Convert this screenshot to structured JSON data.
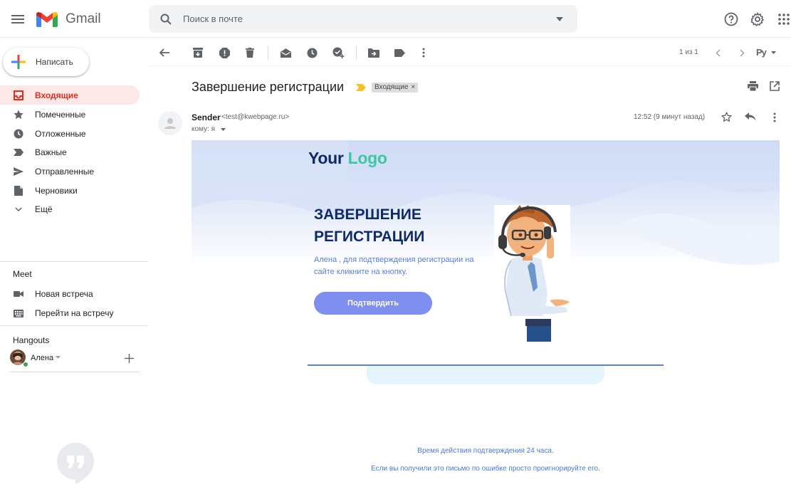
{
  "app": {
    "name": "Gmail"
  },
  "search": {
    "placeholder": "Поиск в почте"
  },
  "compose": {
    "label": "Написать"
  },
  "sidebar": {
    "items": [
      {
        "label": "Входящие",
        "icon": "inbox-icon",
        "active": true
      },
      {
        "label": "Помеченные",
        "icon": "star-icon"
      },
      {
        "label": "Отложенные",
        "icon": "clock-icon"
      },
      {
        "label": "Важные",
        "icon": "important-icon"
      },
      {
        "label": "Отправленные",
        "icon": "send-icon"
      },
      {
        "label": "Черновики",
        "icon": "draft-icon"
      },
      {
        "label": "Ещё",
        "icon": "chevron-down-icon"
      }
    ]
  },
  "meet": {
    "title": "Meet",
    "items": [
      {
        "label": "Новая встреча",
        "icon": "videocam-icon"
      },
      {
        "label": "Перейти на встречу",
        "icon": "keyboard-icon"
      }
    ]
  },
  "hangouts": {
    "title": "Hangouts",
    "user": "Алена"
  },
  "toolbar": {
    "pagination": "1 из 1",
    "input_tool": "Ру"
  },
  "message": {
    "subject": "Завершение регистрации",
    "label": "Входящие",
    "sender_name": "Sender",
    "sender_email": "<test@kwebpage.ru>",
    "to": "кому: я",
    "time": "12:52 (9 минут назад)"
  },
  "email": {
    "logo_word1": "Your",
    "logo_word2": "Logo",
    "headline_line1": "ЗАВЕРШЕНИЕ",
    "headline_line2": "РЕГИСТРАЦИИ",
    "body_text": "Алена , для подтверждения регистрации на сайте кликните на кнопку.",
    "button": "Подтвердить",
    "footer_line1": "Время действия подтверждения 24 часа.",
    "footer_line2": "Если вы получили это письмо по ошибке просто проигнорируйте его."
  },
  "colors": {
    "active_nav_bg": "#fce8e6",
    "active_nav_text": "#d93025",
    "headline": "#0f2a6b",
    "button": "#7f8ff0",
    "logo_dark": "#0f2a6b",
    "logo_accent": "#3cc7a3",
    "link_text": "#4a7ad0"
  }
}
